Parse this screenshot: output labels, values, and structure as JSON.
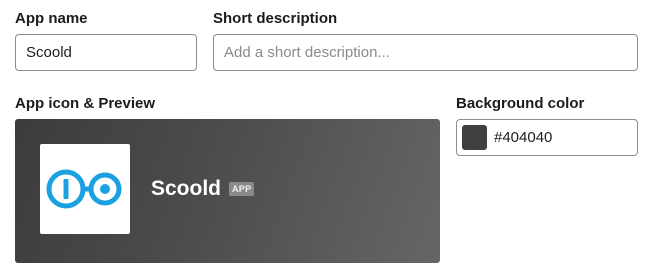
{
  "form": {
    "app_name_label": "App name",
    "app_name_value": "Scoold",
    "short_description_label": "Short description",
    "short_description_value": "",
    "short_description_placeholder": "Add a short description...",
    "icon_preview_label": "App icon & Preview",
    "background_color_label": "Background color",
    "background_color_value": "#404040"
  },
  "preview": {
    "app_name": "Scoold",
    "badge": "APP",
    "icon": "scoold-logo-icon"
  },
  "colors": {
    "preview_background": "#404040",
    "logo_blue": "#1ba1e2",
    "label_text": "#1d1c1d"
  }
}
